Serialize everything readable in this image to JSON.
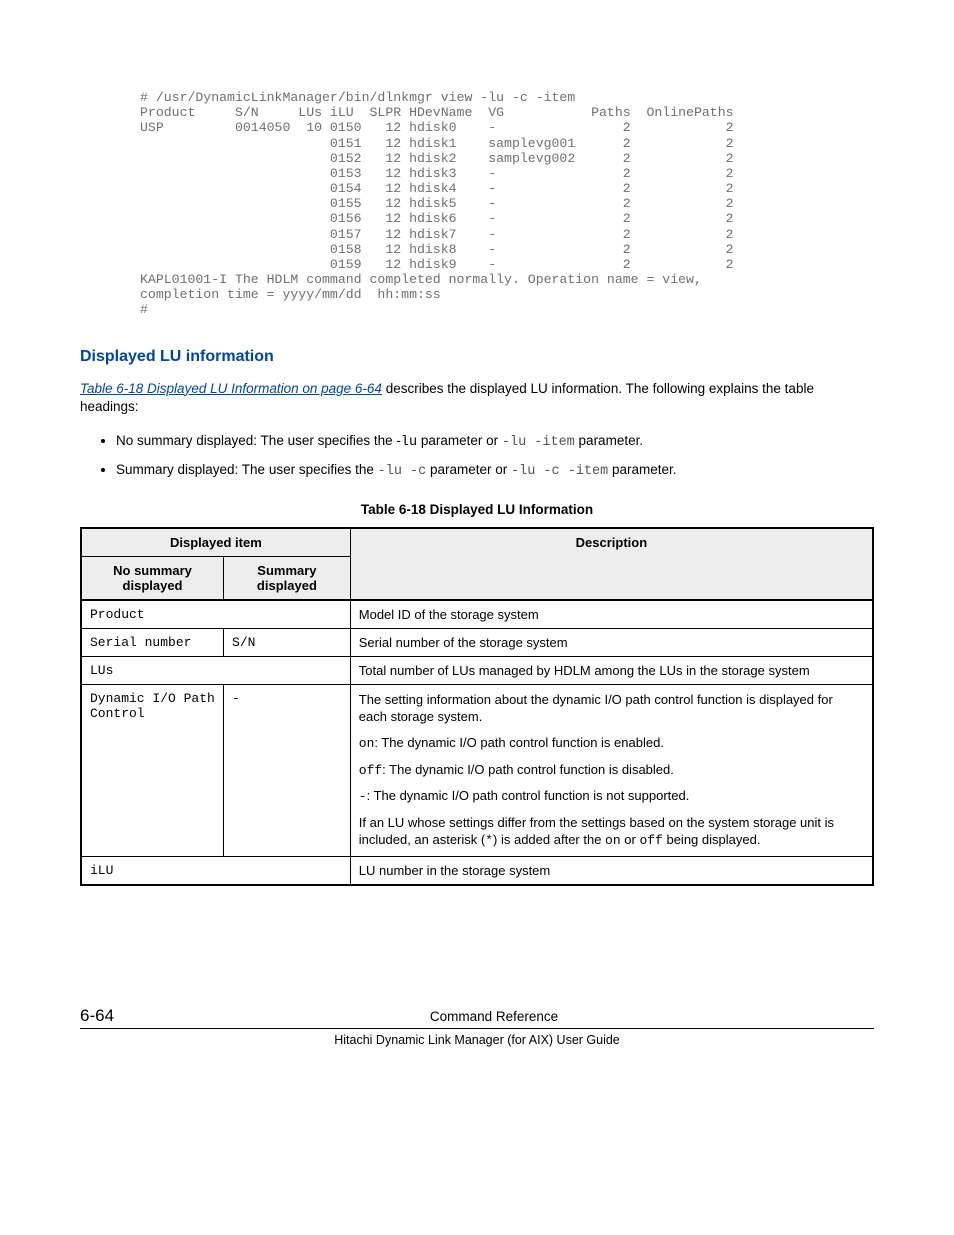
{
  "code_output": "# /usr/DynamicLinkManager/bin/dlnkmgr view -lu -c -item\nProduct     S/N     LUs iLU  SLPR HDevName  VG           Paths  OnlinePaths\nUSP         0014050  10 0150   12 hdisk0    -                2            2\n                        0151   12 hdisk1    samplevg001      2            2\n                        0152   12 hdisk2    samplevg002      2            2\n                        0153   12 hdisk3    -                2            2\n                        0154   12 hdisk4    -                2            2\n                        0155   12 hdisk5    -                2            2\n                        0156   12 hdisk6    -                2            2\n                        0157   12 hdisk7    -                2            2\n                        0158   12 hdisk8    -                2            2\n                        0159   12 hdisk9    -                2            2\nKAPL01001-I The HDLM command completed normally. Operation name = view,\ncompletion time = yyyy/mm/dd  hh:mm:ss\n#",
  "heading": "Displayed LU information",
  "intro": {
    "link_text": "Table 6-18 Displayed LU Information on page 6-64",
    "after_link": " describes the displayed LU information. The following explains the table headings:"
  },
  "bullets": {
    "b1_pre": "No summary displayed: The user specifies the -",
    "b1_m1": "lu",
    "b1_mid": " parameter or ",
    "b1_m2": "-lu -item",
    "b1_post": " parameter.",
    "b2_pre": "Summary displayed: The user specifies the ",
    "b2_m1": "-lu -c",
    "b2_mid": " parameter or ",
    "b2_m2": "-lu -c -item",
    "b2_post": " parameter."
  },
  "table_caption": "Table 6-18 Displayed LU Information",
  "thead": {
    "displayed_item": "Displayed item",
    "no_summary": "No summary displayed",
    "summary": "Summary displayed",
    "description": "Description"
  },
  "rows": {
    "r1": {
      "col1": "Product",
      "desc": "Model ID of the storage system"
    },
    "r2": {
      "col1": "Serial number",
      "col2": "S/N",
      "desc": "Serial number of the storage system"
    },
    "r3": {
      "col1": "LUs",
      "desc": "Total number of LUs managed by HDLM among the LUs in the storage system"
    },
    "r4": {
      "col1": "Dynamic I/O Path Control",
      "col2": "-",
      "p1": "The setting information about the dynamic I/O path control function is displayed for each storage system.",
      "on": "on",
      "p2": ": The dynamic I/O path control function is enabled.",
      "off": "off",
      "p3": ": The dynamic I/O path control function is disabled.",
      "dash": "-",
      "p4": ": The dynamic I/O path control function is not supported.",
      "p5a": "If an LU whose settings differ from the settings based on the system storage unit is included, an asterisk (",
      "star": "*",
      "p5b": ") is added after the ",
      "on2": "on",
      "p5c": " or ",
      "off2": "off",
      "p5d": " being displayed."
    },
    "r5": {
      "col1": "iLU",
      "desc": "LU number in the storage system"
    }
  },
  "footer": {
    "page": "6-64",
    "title": "Command Reference",
    "sub": "Hitachi Dynamic Link Manager (for AIX) User Guide"
  }
}
